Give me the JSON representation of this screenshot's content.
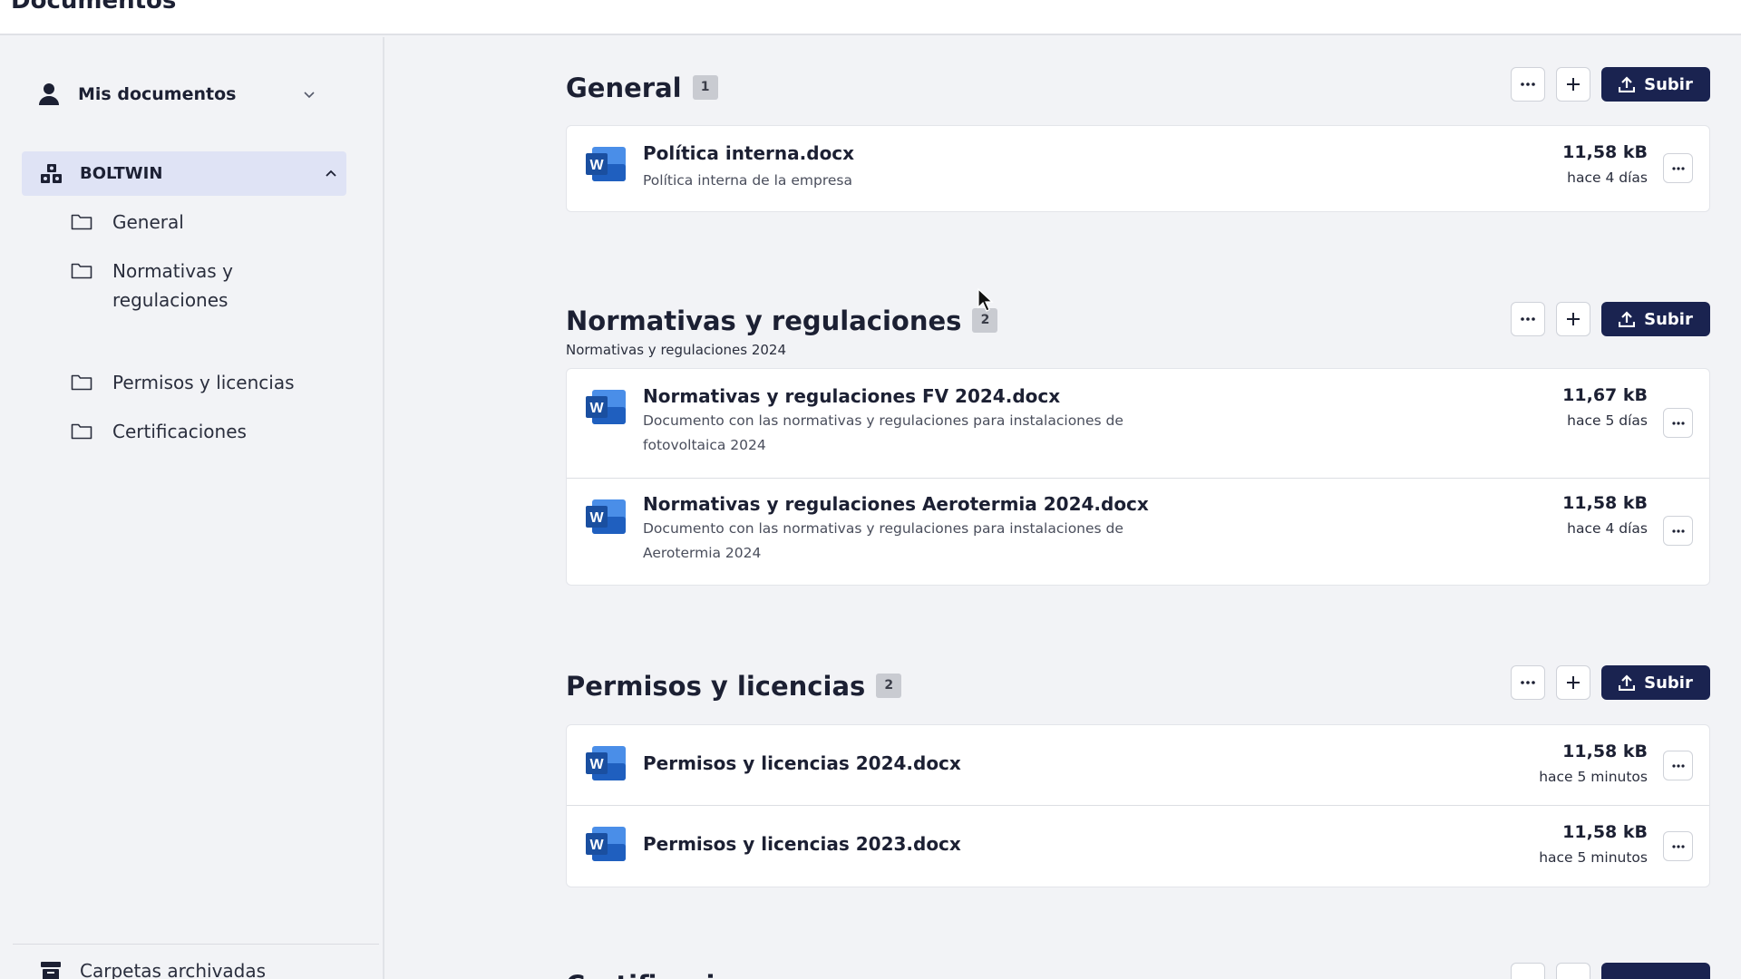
{
  "page": {
    "title": "Documentos"
  },
  "sidebar": {
    "my_documents": "Mis documentos",
    "team": "BOLTWIN",
    "folders": [
      {
        "label": "General"
      },
      {
        "label": "Normativas y regulaciones"
      },
      {
        "label": "Permisos y licencias"
      },
      {
        "label": "Certificaciones"
      }
    ],
    "archived": "Carpetas archivadas"
  },
  "actions": {
    "upload_label": "Subir"
  },
  "sections": [
    {
      "title": "General",
      "count": "1",
      "files": [
        {
          "name": "Política interna.docx",
          "description": "Política interna de la empresa",
          "size": "11,58 kB",
          "modified": "hace 4 días"
        }
      ]
    },
    {
      "title": "Normativas y regulaciones",
      "count": "2",
      "subtitle": "Normativas y regulaciones 2024",
      "files": [
        {
          "name": "Normativas y regulaciones FV 2024.docx",
          "description": "Documento con las normativas y regulaciones para instalaciones de fotovoltaica 2024",
          "size": "11,67 kB",
          "modified": "hace 5 días"
        },
        {
          "name": "Normativas y regulaciones Aerotermia 2024.docx",
          "description": "Documento con las normativas y regulaciones para instalaciones de Aerotermia 2024",
          "size": "11,58 kB",
          "modified": "hace 4 días"
        }
      ]
    },
    {
      "title": "Permisos y licencias",
      "count": "2",
      "files": [
        {
          "name": "Permisos y licencias 2024.docx",
          "size": "11,58 kB",
          "modified": "hace 5 minutos"
        },
        {
          "name": "Permisos y licencias 2023.docx",
          "size": "11,58 kB",
          "modified": "hace 5 minutos"
        }
      ]
    },
    {
      "title": "Certificaciones"
    }
  ],
  "icons": {
    "file_type": "word-docx-icon",
    "accent": "#1a2350",
    "word_blue": "#1f5fbf"
  }
}
